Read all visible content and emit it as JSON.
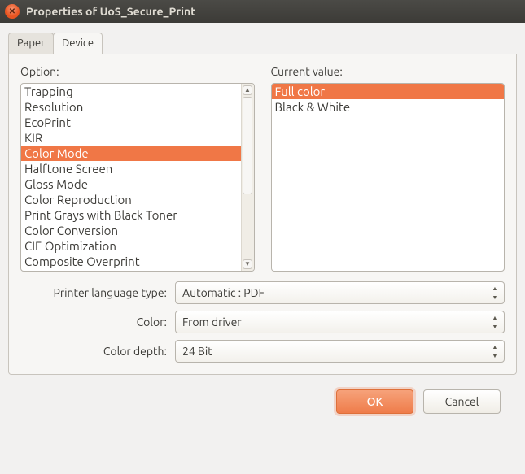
{
  "window": {
    "title": "Properties of UoS_Secure_Print"
  },
  "tabs": {
    "paper": "Paper",
    "device": "Device",
    "active": "device"
  },
  "option": {
    "label": "Option:",
    "items": [
      "Trapping",
      "Resolution",
      "EcoPrint",
      "KIR",
      "Color Mode",
      "Halftone Screen",
      "Gloss Mode",
      "Color Reproduction",
      "Print Grays with Black Toner",
      "Color Conversion",
      "CIE Optimization",
      "Composite Overprint"
    ],
    "selected_index": 4
  },
  "current_value": {
    "label": "Current value:",
    "items": [
      "Full color",
      "Black & White"
    ],
    "selected_index": 0
  },
  "fields": {
    "printer_language": {
      "label": "Printer language type:",
      "value": "Automatic : PDF"
    },
    "color": {
      "label": "Color:",
      "value": "From driver"
    },
    "color_depth": {
      "label": "Color depth:",
      "value": "24 Bit"
    }
  },
  "buttons": {
    "ok": "OK",
    "cancel": "Cancel"
  }
}
